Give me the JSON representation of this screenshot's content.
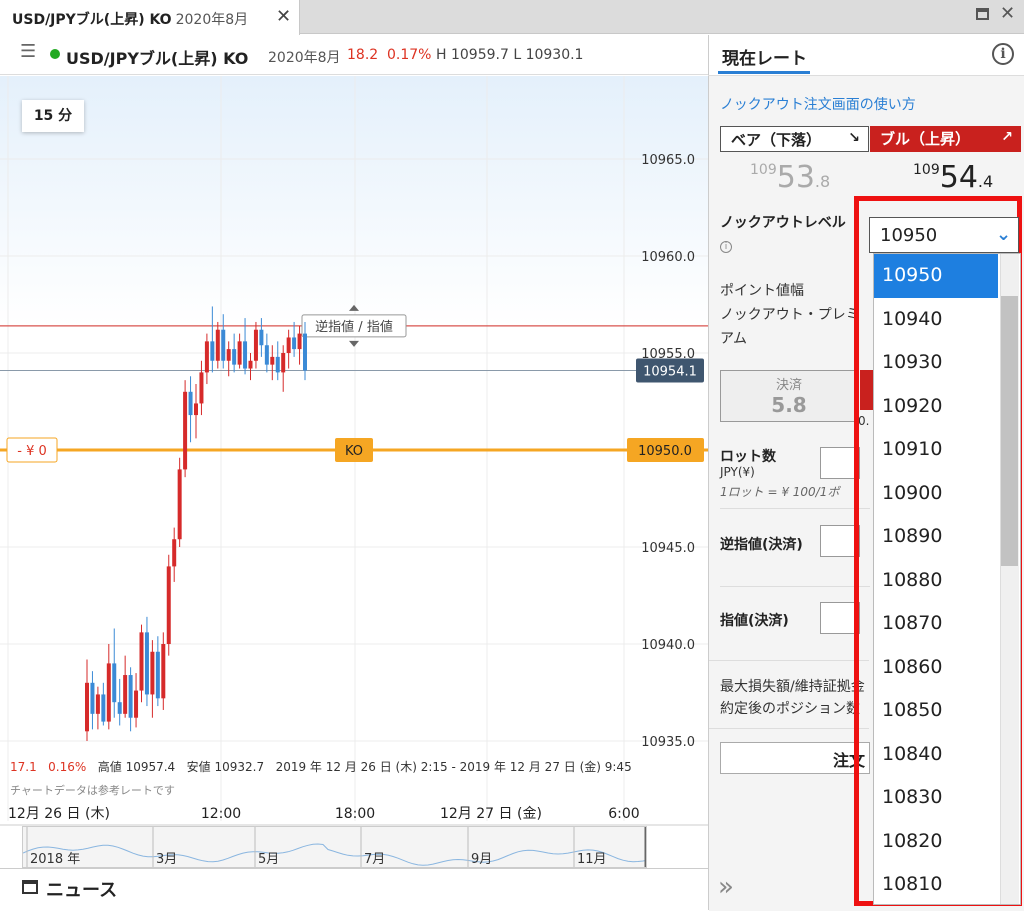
{
  "tab": {
    "title": "USD/JPYブル(上昇) KO",
    "subtitle": "2020年8月",
    "close": "✕"
  },
  "window": {
    "close": "✕"
  },
  "header": {
    "menu": "☰",
    "title": "USD/JPYブル(上昇) KO",
    "month": "2020年8月",
    "change": "18.2",
    "change_pct": "0.17%",
    "high_low": "H 10959.7  L 10930.1"
  },
  "panel": {
    "tab_label": "現在レート",
    "info": "i",
    "howto_link": "ノックアウト注文画面の使い方",
    "bear": {
      "label": "ベア（下落）",
      "arrow": "↘",
      "price_small": "109",
      "price_big": "53",
      "price_tail": ".8"
    },
    "bull": {
      "label": "ブル（上昇）",
      "arrow": "↗",
      "price_small": "109",
      "price_big": "54",
      "price_tail": ".4"
    },
    "ko_level_label": "ノックアウトレベル",
    "ko_info": "i",
    "point_width_label": "ポイント値幅",
    "premium_label_1": "ノックアウト・プレミ",
    "premium_label_2": "アム",
    "settle_label": "決済",
    "settle_value": "5.8",
    "settle_partial": "0.",
    "lot_label": "ロット数",
    "lot_unit": "JPY(¥)",
    "lot_note": "1ロット = ¥ 100/1ポ",
    "stop_label": "逆指値(決済)",
    "limit_label": "指値(決済)",
    "max_loss_label": "最大損失額/維持証拠金",
    "position_label": "約定後のポジション数",
    "order_button": "注文",
    "expand": "»"
  },
  "chart": {
    "timeframe": "15 分",
    "current_price_tag": "10954.1",
    "ko_price_tag": "10950.0",
    "ko_label": "KO",
    "ko_pl": "- ¥ 0",
    "order_line_label": "逆指値 / 指値",
    "stats_change": "17.1",
    "stats_pct": "0.16%",
    "stats_high": "高値 10957.4",
    "stats_low": "安値 10932.7",
    "stats_range": "2019 年 12 月 26 日 (木) 2:15 - 2019 年 12 月 27 日 (金) 9:45",
    "ref_note": "チャートデータは参考レートです",
    "x_labels": [
      "12月 26 日 (木)",
      "12:00",
      "18:00",
      "12月 27 日 (金)",
      "6:00"
    ],
    "navigator_labels": [
      "2018 年",
      "3月",
      "5月",
      "7月",
      "9月",
      "11月"
    ]
  },
  "chart_data": {
    "type": "candlestick",
    "ylim": [
      10934,
      10968
    ],
    "y_ticks": [
      10965.0,
      10960.0,
      10955.0,
      10950.0,
      10945.0,
      10940.0,
      10935.0
    ],
    "y_tick_labels": [
      "10965.0",
      "10960.0",
      "10955.0",
      "10950.0",
      "10945.0",
      "10940.0",
      "10935.0"
    ],
    "candles": [
      {
        "o": 10935.5,
        "h": 10939.2,
        "l": 10935.0,
        "c": 10938.0
      },
      {
        "o": 10938.0,
        "h": 10938.6,
        "l": 10935.6,
        "c": 10936.4
      },
      {
        "o": 10936.4,
        "h": 10937.8,
        "l": 10935.6,
        "c": 10937.4
      },
      {
        "o": 10937.4,
        "h": 10938.0,
        "l": 10935.8,
        "c": 10936.0
      },
      {
        "o": 10936.0,
        "h": 10940.0,
        "l": 10935.6,
        "c": 10939.0
      },
      {
        "o": 10939.0,
        "h": 10940.8,
        "l": 10936.2,
        "c": 10937.0
      },
      {
        "o": 10937.0,
        "h": 10938.2,
        "l": 10935.8,
        "c": 10936.4
      },
      {
        "o": 10936.4,
        "h": 10939.4,
        "l": 10936.2,
        "c": 10938.4
      },
      {
        "o": 10938.4,
        "h": 10938.8,
        "l": 10935.5,
        "c": 10936.2
      },
      {
        "o": 10936.2,
        "h": 10938.5,
        "l": 10935.7,
        "c": 10937.6
      },
      {
        "o": 10937.6,
        "h": 10941.0,
        "l": 10937.0,
        "c": 10940.6
      },
      {
        "o": 10940.6,
        "h": 10941.4,
        "l": 10936.8,
        "c": 10937.4
      },
      {
        "o": 10937.4,
        "h": 10940.2,
        "l": 10936.2,
        "c": 10939.6
      },
      {
        "o": 10939.6,
        "h": 10940.4,
        "l": 10936.8,
        "c": 10937.2
      },
      {
        "o": 10937.2,
        "h": 10940.6,
        "l": 10936.6,
        "c": 10940.0
      },
      {
        "o": 10940.0,
        "h": 10944.6,
        "l": 10939.4,
        "c": 10944.0
      },
      {
        "o": 10944.0,
        "h": 10946.0,
        "l": 10943.2,
        "c": 10945.4
      },
      {
        "o": 10945.4,
        "h": 10949.6,
        "l": 10945.0,
        "c": 10949.0
      },
      {
        "o": 10949.0,
        "h": 10953.6,
        "l": 10948.6,
        "c": 10953.0
      },
      {
        "o": 10953.0,
        "h": 10953.8,
        "l": 10950.4,
        "c": 10951.8
      },
      {
        "o": 10951.8,
        "h": 10953.4,
        "l": 10950.6,
        "c": 10952.4
      },
      {
        "o": 10952.4,
        "h": 10954.6,
        "l": 10951.8,
        "c": 10954.0
      },
      {
        "o": 10954.0,
        "h": 10956.0,
        "l": 10953.4,
        "c": 10955.6
      },
      {
        "o": 10955.6,
        "h": 10957.4,
        "l": 10954.0,
        "c": 10954.6
      },
      {
        "o": 10954.6,
        "h": 10956.6,
        "l": 10954.2,
        "c": 10956.2
      },
      {
        "o": 10956.2,
        "h": 10957.0,
        "l": 10954.2,
        "c": 10954.6
      },
      {
        "o": 10954.6,
        "h": 10955.6,
        "l": 10953.8,
        "c": 10955.2
      },
      {
        "o": 10955.2,
        "h": 10956.0,
        "l": 10954.0,
        "c": 10954.4
      },
      {
        "o": 10954.4,
        "h": 10956.0,
        "l": 10954.2,
        "c": 10955.6
      },
      {
        "o": 10955.6,
        "h": 10956.8,
        "l": 10953.9,
        "c": 10954.2
      },
      {
        "o": 10954.2,
        "h": 10955.0,
        "l": 10953.6,
        "c": 10954.6
      },
      {
        "o": 10954.6,
        "h": 10956.6,
        "l": 10954.2,
        "c": 10956.2
      },
      {
        "o": 10956.2,
        "h": 10956.8,
        "l": 10954.8,
        "c": 10955.4
      },
      {
        "o": 10955.4,
        "h": 10956.0,
        "l": 10954.0,
        "c": 10954.4
      },
      {
        "o": 10954.4,
        "h": 10955.4,
        "l": 10953.6,
        "c": 10954.8
      },
      {
        "o": 10954.8,
        "h": 10955.6,
        "l": 10953.6,
        "c": 10954.0
      },
      {
        "o": 10954.0,
        "h": 10955.4,
        "l": 10953.0,
        "c": 10955.0
      },
      {
        "o": 10955.0,
        "h": 10956.2,
        "l": 10954.2,
        "c": 10955.8
      },
      {
        "o": 10955.8,
        "h": 10956.6,
        "l": 10954.8,
        "c": 10955.2
      },
      {
        "o": 10955.2,
        "h": 10956.4,
        "l": 10954.4,
        "c": 10956.0
      },
      {
        "o": 10956.0,
        "h": 10956.6,
        "l": 10953.6,
        "c": 10954.1
      }
    ],
    "knockout_level": 10950.0,
    "order_level": 10956.4,
    "current_price": 10954.1
  },
  "dropdown": {
    "selected": "10950",
    "chevron": "⌄",
    "options": [
      "10950",
      "10940",
      "10930",
      "10920",
      "10910",
      "10900",
      "10890",
      "10880",
      "10870",
      "10860",
      "10850",
      "10840",
      "10830",
      "10820",
      "10810"
    ]
  },
  "news": {
    "label": "ニュース"
  },
  "colors": {
    "accent": "#2a7fd4",
    "bull": "#c9211e",
    "ko_line": "#f5a623",
    "highlight": "#ee1111"
  }
}
